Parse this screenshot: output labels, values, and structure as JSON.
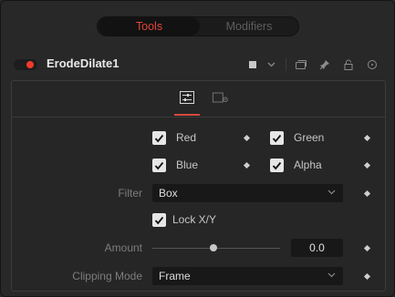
{
  "tabs": {
    "tools": "Tools",
    "modifiers": "Modifiers",
    "active": "Tools"
  },
  "tool": {
    "name": "ErodeDilate1",
    "enabled": true,
    "icons": [
      "color-swatch-icon",
      "chevron-down-icon",
      "window-icon",
      "pin-icon",
      "lock-icon",
      "reset-icon"
    ]
  },
  "panel_tabs": {
    "controls_icon": "sliders-icon",
    "settings_icon": "settings-icon",
    "active": "controls"
  },
  "channels": [
    {
      "label": "Red",
      "checked": true
    },
    {
      "label": "Green",
      "checked": true
    },
    {
      "label": "Blue",
      "checked": true
    },
    {
      "label": "Alpha",
      "checked": true
    }
  ],
  "filter": {
    "label": "Filter",
    "value": "Box"
  },
  "lock_xy": {
    "label": "Lock X/Y",
    "checked": true
  },
  "amount": {
    "label": "Amount",
    "value": "0.0",
    "slider_fraction": 0.5
  },
  "clipping_mode": {
    "label": "Clipping Mode",
    "value": "Frame"
  },
  "colors": {
    "accent": "#e04438",
    "toggle_on": "#f03a2e",
    "background": "#282828"
  }
}
